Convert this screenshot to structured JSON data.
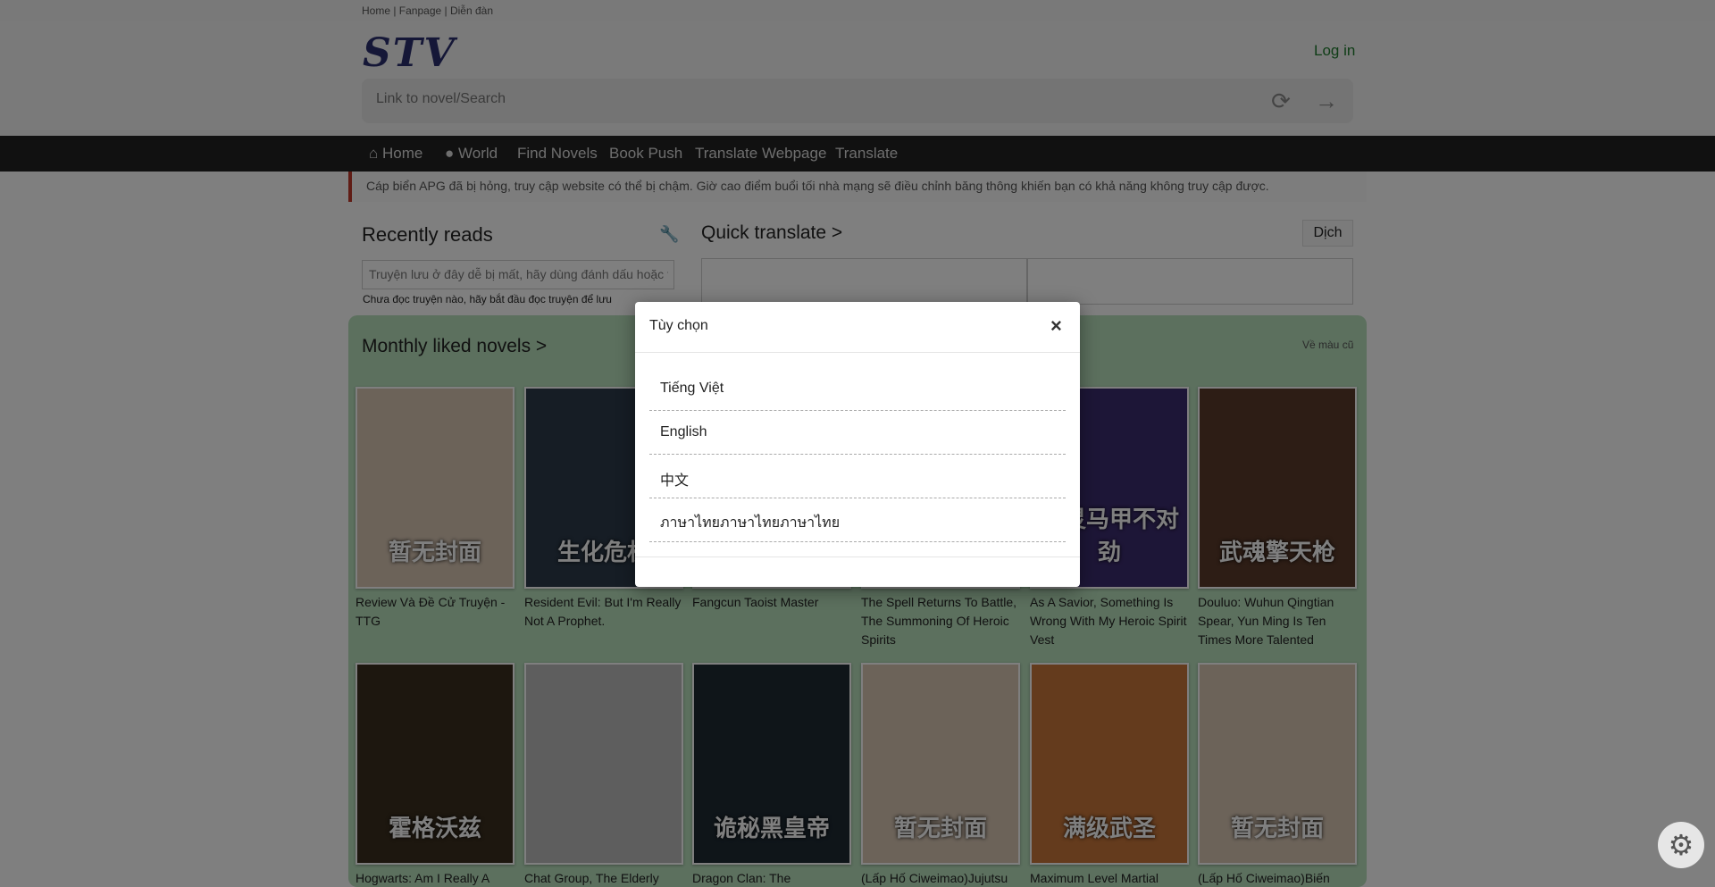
{
  "topbar": {
    "links": "Home | Fanpage | Diễn đàn"
  },
  "header": {
    "logo": "STV",
    "login": "Log in",
    "search_placeholder": "Link to novel/Search",
    "refresh_icon": "refresh-icon",
    "go_icon": "arrow-right-icon"
  },
  "nav": [
    {
      "label": "Home",
      "icon": "home-icon"
    },
    {
      "label": "World",
      "icon": "comment-icon"
    },
    {
      "label": "Find Novels"
    },
    {
      "label": "Book Push"
    },
    {
      "label": "Translate Webpage"
    },
    {
      "label": "Translate"
    }
  ],
  "notice": "Cáp biển APG đã bị hỏng, truy cập website có thể bị chậm. Giờ cao điểm buổi tối nhà mạng sẽ điều chỉnh băng thông khiến bạn có khả năng không truy cập được.",
  "recent": {
    "title": "Recently reads",
    "input_text": "Truyện lưu ở đây dễ bị mất, hãy dùng đánh dấu hoặc th",
    "empty": "Chưa đọc truyện nào, hãy bắt đầu đọc truyện để lưu"
  },
  "quick": {
    "title": "Quick translate >",
    "button": "Dịch"
  },
  "monthly": {
    "title": "Monthly liked novels >",
    "old_colors": "Về màu cũ",
    "row1": [
      {
        "title": "Review Và Đề Cử Truyện - TTG",
        "cover": "暂无封面",
        "color": "#d8c6b3"
      },
      {
        "title": "Resident Evil: But I'm Really Not A Prophet.",
        "cover": "生化危机",
        "color": "#2c3a4a"
      },
      {
        "title": "Fangcun Taoist Master",
        "cover": "",
        "color": "#4a5a3a"
      },
      {
        "title": "The Spell Returns To Battle, The Summoning Of Heroic Spirits",
        "cover": "",
        "color": "#3a3a6a"
      },
      {
        "title": "As A Savior, Something Is Wrong With My Heroic Spirit Vest",
        "cover": "英灵马甲不对劲",
        "color": "#3b2c6e"
      },
      {
        "title": "Douluo: Wuhun Qingtian Spear, Yun Ming Is Ten Times More Talented",
        "cover": "武魂擎天枪",
        "color": "#5a3a2a"
      }
    ],
    "row2": [
      {
        "title": "Hogwarts: Am I Really A",
        "cover": "霍格沃兹",
        "color": "#3a2e1e"
      },
      {
        "title": "Chat Group, The Elderly",
        "cover": "",
        "color": "#bdbdbd"
      },
      {
        "title": "Dragon Clan: The Mysterious",
        "cover": "诡秘黑皇帝",
        "color": "#1e2a33"
      },
      {
        "title": "(Lấp Hố Ciweimao)Jujutsu",
        "cover": "暂无封面",
        "color": "#d8c6b3"
      },
      {
        "title": "Maximum Level Martial",
        "cover": "满级武圣",
        "color": "#c8763a"
      },
      {
        "title": "(Lấp Hố Ciweimao)Biến",
        "cover": "暂无封面",
        "color": "#d8c6b3"
      }
    ]
  },
  "modal": {
    "title": "Tùy chọn",
    "close_icon": "close-icon",
    "languages": [
      "Tiếng Việt",
      "English",
      "中文",
      "ภาษาไทยภาษาไทยภาษาไทย"
    ]
  },
  "fab": {
    "icon": "settings-gear-icon"
  }
}
